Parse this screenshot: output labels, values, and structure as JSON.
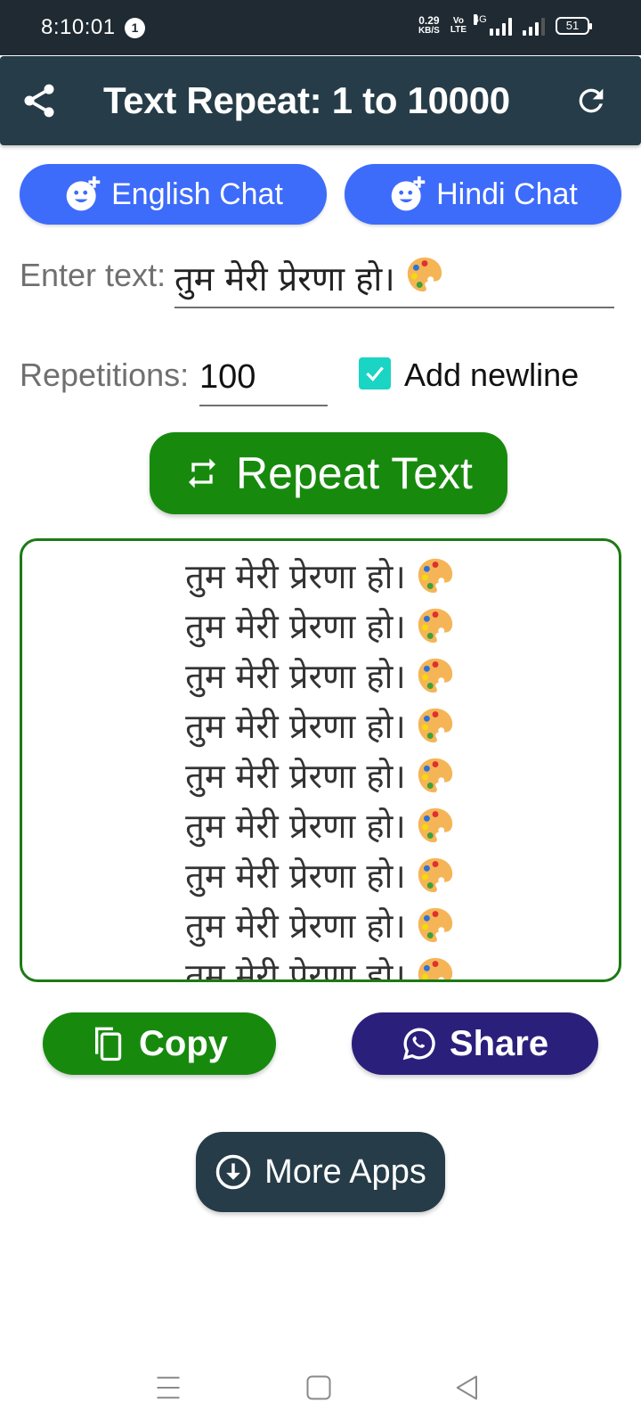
{
  "status_bar": {
    "time": "8:10:01",
    "notification_count": "1",
    "net_speed_value": "0.29",
    "net_speed_unit": "KB/S",
    "volte_top": "Vo",
    "volte_bottom": "LTE",
    "network_type": "4G",
    "battery": "51"
  },
  "app_bar": {
    "title": "Text Repeat: 1 to 10000",
    "share_icon": "share-icon",
    "refresh_icon": "refresh-icon"
  },
  "chat_buttons": {
    "english_label": "English Chat",
    "hindi_label": "Hindi Chat",
    "icon": "add-emoji-icon"
  },
  "form": {
    "enter_text_label": "Enter text:",
    "enter_text_value": "तुम मेरी प्रेरणा हो।",
    "enter_text_emoji": "artist-palette",
    "repetitions_label": "Repetitions:",
    "repetitions_value": "100",
    "add_newline_label": "Add newline",
    "add_newline_checked": true
  },
  "repeat_button": {
    "label": "Repeat Text",
    "icon": "repeat-icon"
  },
  "output": {
    "line_text": "तुम मेरी प्रेरणा हो।",
    "line_emoji": "artist-palette",
    "visible_lines": 9
  },
  "actions": {
    "copy_label": "Copy",
    "share_label": "Share",
    "copy_icon": "copy-icon",
    "share_icon": "whatsapp-icon"
  },
  "more_apps": {
    "label": "More Apps",
    "icon": "download-circle-icon"
  },
  "colors": {
    "header": "#263c48",
    "status_bar": "#1f2a32",
    "chat_blue": "#3d6bfa",
    "green": "#178a0e",
    "share_purple": "#2b1f7c",
    "checkbox_teal": "#1ad4c4"
  }
}
